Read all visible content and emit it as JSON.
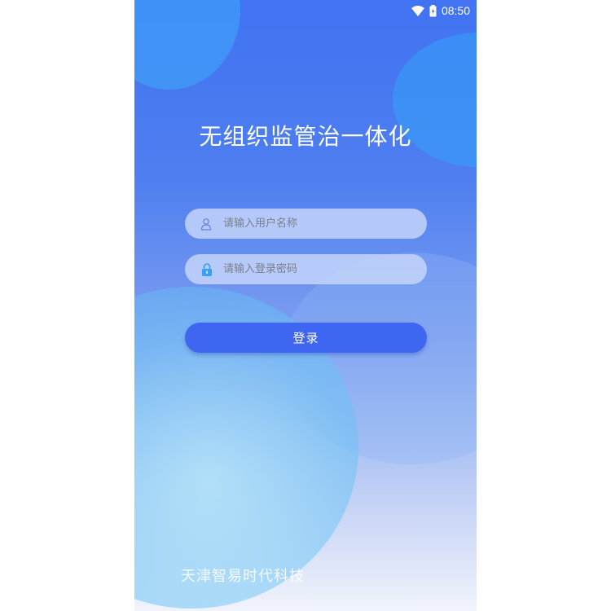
{
  "status_bar": {
    "time": "08:50",
    "icons": [
      "wifi-icon",
      "battery-icon"
    ]
  },
  "login": {
    "title": "无组织监管治一体化",
    "username": {
      "placeholder": "请输入用户名称",
      "value": "",
      "icon": "user-icon"
    },
    "password": {
      "placeholder": "请输入登录密码",
      "value": "",
      "icon": "lock-icon"
    },
    "submit_label": "登录"
  },
  "footer": {
    "company": "天津智易时代科技"
  },
  "colors": {
    "primary_button": "#3f66f0",
    "background_top": "#4173f2",
    "background_bottom": "#f1f4fc",
    "field_background": "#c8d7fa",
    "lock_accent": "#3aa0f5"
  }
}
